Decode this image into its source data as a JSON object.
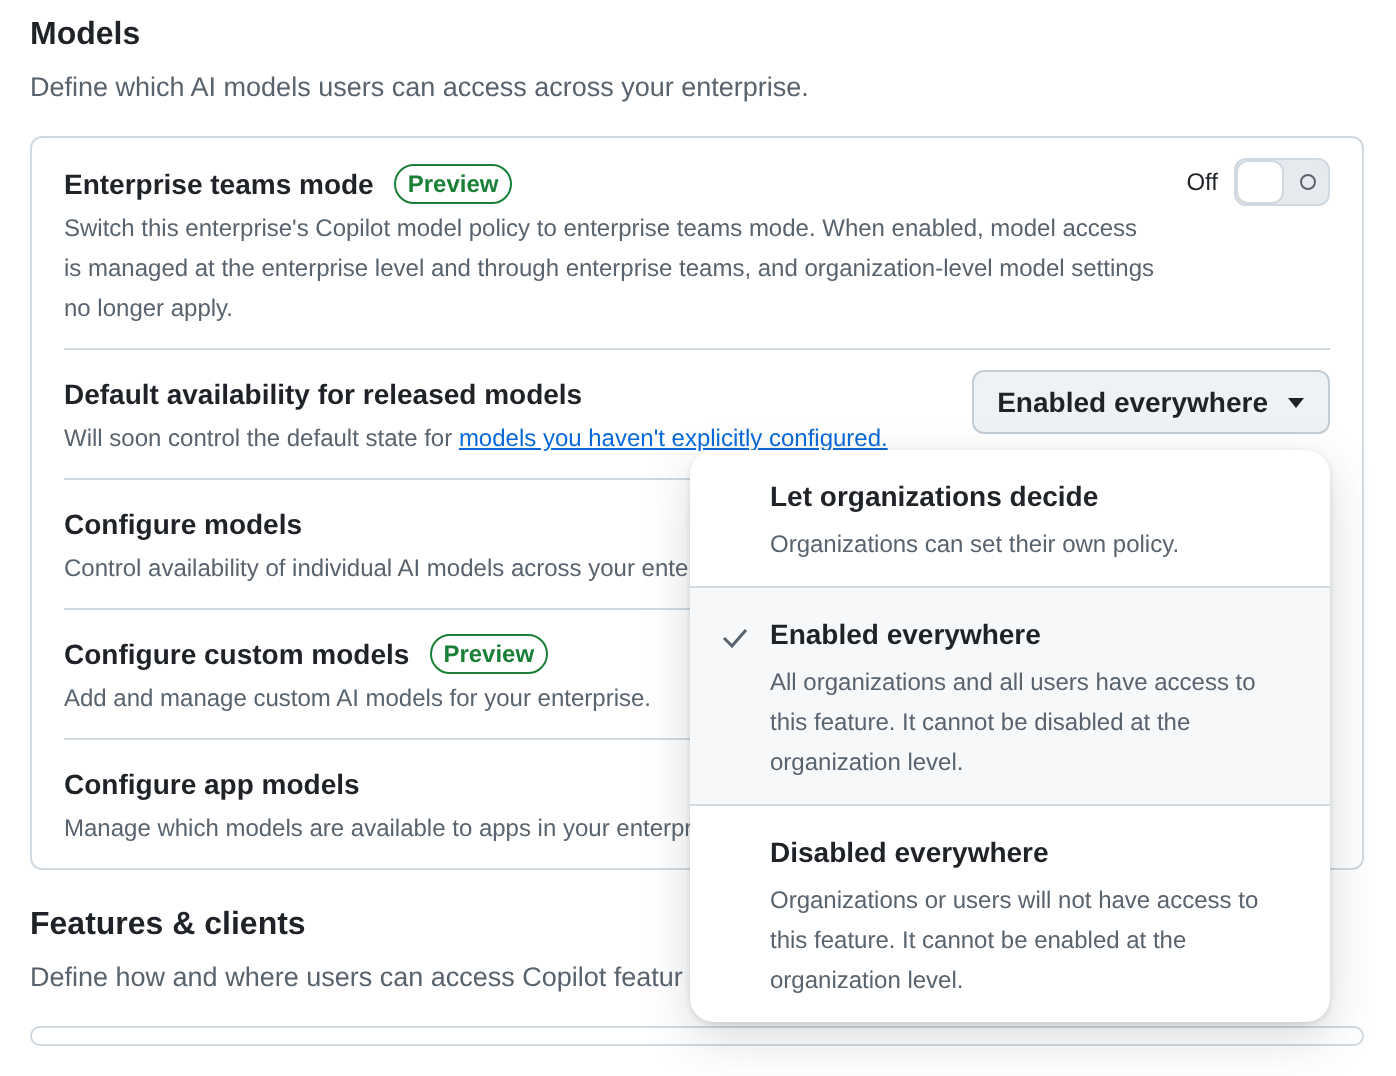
{
  "sections": [
    {
      "title": "Models",
      "description": "Define which AI models users can access across your enterprise.",
      "settings": [
        {
          "kind": "toggle",
          "title": "Enterprise teams mode",
          "badge": "Preview",
          "description": "Switch this enterprise's Copilot model policy to enterprise teams mode. When enabled, model access is managed at the enterprise level and through enterprise teams, and organization-level model settings no longer apply.",
          "toggle_label": "Off",
          "on": false
        },
        {
          "kind": "dropdown",
          "title": "Default availability for released models",
          "description": "Will soon control the default state for ",
          "link": "models you haven't explicitly configured.",
          "value": "Enabled everywhere",
          "expanded": true,
          "options": [
            {
              "title": "Let organizations decide",
              "description": "Organizations can set their own policy.",
              "selected": false
            },
            {
              "title": "Enabled everywhere",
              "description": "All organizations and all users have access to this feature. It cannot be disabled at the organization level.",
              "selected": true
            },
            {
              "title": "Disabled everywhere",
              "description": "Organizations or users will not have access to this feature. It cannot be enabled at the organization level.",
              "selected": false
            }
          ]
        },
        {
          "kind": "plain",
          "title": "Configure models",
          "description": "Control availability of individual AI models across your ente"
        },
        {
          "kind": "plain",
          "title": "Configure custom models",
          "badge": "Preview",
          "description": "Add and manage custom AI models for your enterprise."
        },
        {
          "kind": "plain",
          "title": "Configure app models",
          "description": "Manage which models are available to apps in your enterpr"
        }
      ]
    },
    {
      "title": "Features & clients",
      "description": "Define how and where users can access Copilot featur"
    }
  ]
}
